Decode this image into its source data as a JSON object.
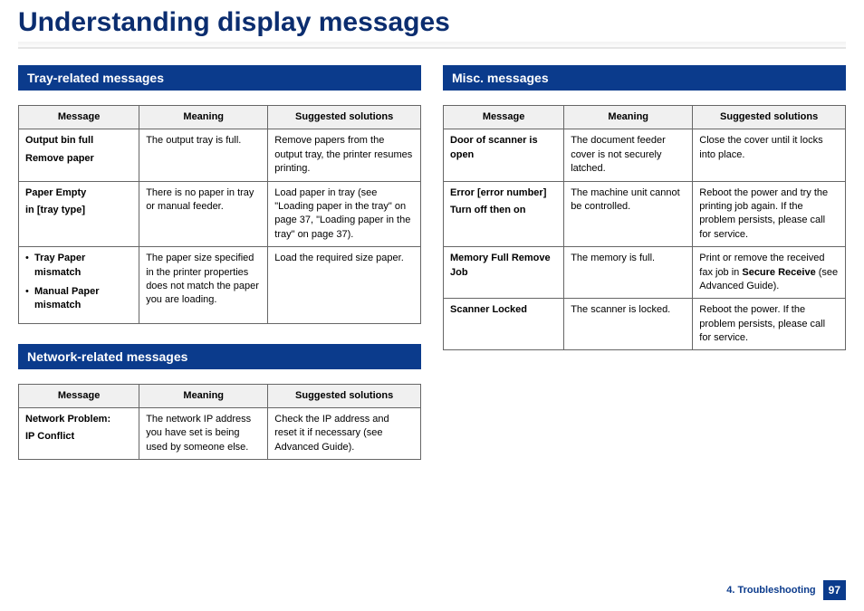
{
  "page_title": "Understanding display messages",
  "footer": {
    "chapter": "4. Troubleshooting",
    "page": "97"
  },
  "columns_header": {
    "message": "Message",
    "meaning": "Meaning",
    "solutions": "Suggested solutions"
  },
  "sections": {
    "tray": {
      "title": "Tray-related messages",
      "rows": [
        {
          "msg_line1": "Output bin full",
          "msg_line2": "Remove paper",
          "meaning": "The output tray is full.",
          "solution": "Remove papers from the output tray, the printer resumes printing."
        },
        {
          "msg_line1": "Paper Empty",
          "msg_line2": "in [tray type]",
          "meaning": "There is no paper in tray or manual feeder.",
          "solution": "Load paper in tray (see \"Loading paper in the tray\" on page 37, \"Loading paper in the tray\" on page 37)."
        },
        {
          "bullets": [
            "Tray Paper mismatch",
            "Manual Paper mismatch"
          ],
          "meaning": "The paper size specified in the printer properties does not match the paper you are loading.",
          "solution": "Load the required size paper."
        }
      ]
    },
    "network": {
      "title": "Network-related messages",
      "rows": [
        {
          "msg_line1": "Network Problem:",
          "msg_line2": "IP Conflict",
          "meaning": "The network IP address you have set is being used by someone else.",
          "solution": "Check the IP address and reset it if necessary (see Advanced Guide)."
        }
      ]
    },
    "misc": {
      "title": "Misc. messages",
      "rows": [
        {
          "msg_line1": "Door of scanner is open",
          "meaning": "The document feeder cover is not securely latched.",
          "solution": "Close the cover until it locks into place."
        },
        {
          "msg_line1": "Error [error number]",
          "msg_line2": "Turn off then on",
          "meaning": "The machine unit cannot be controlled.",
          "solution": "Reboot the power and try the printing job again. If the problem persists, please call for service."
        },
        {
          "msg_line1": "Memory Full Remove Job",
          "meaning": "The memory is full.",
          "solution_pre": "Print or remove the received fax job in ",
          "solution_bold": "Secure Receive",
          "solution_post": " (see Advanced Guide)."
        },
        {
          "msg_line1": "Scanner Locked",
          "meaning": "The scanner is locked.",
          "solution": "Reboot the power. If the problem persists, please call for service."
        }
      ]
    }
  }
}
